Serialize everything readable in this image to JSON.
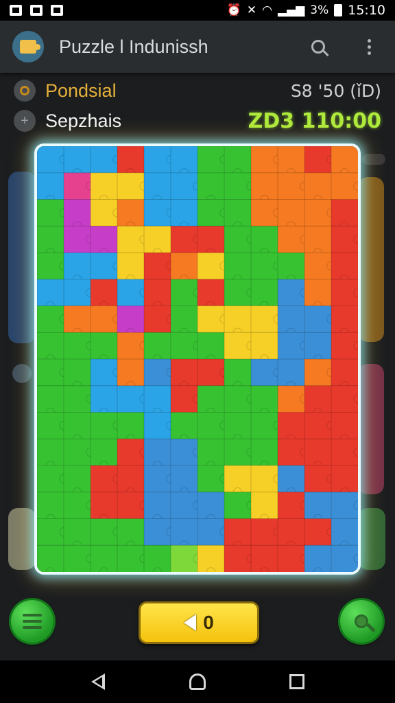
{
  "status_bar": {
    "left_icons": [
      "photo-icon",
      "gallery-icon",
      "notification-icon"
    ],
    "right_icons": [
      "alarm-icon",
      "mute-icon",
      "wifi-icon",
      "signal-icon",
      "battery-icon"
    ],
    "battery": "3%",
    "time": "15:10"
  },
  "app_bar": {
    "title": "Puzzle l Indunissh",
    "icons": [
      "app-icon",
      "search-icon",
      "more-vertical-icon"
    ]
  },
  "info": {
    "row1": {
      "label": "Pondsial",
      "value": "S8 '50 (ǐD)",
      "icon": "coin-icon"
    },
    "row2": {
      "label": "Sepzhais",
      "value": "ZD3 110:00",
      "icon": "plus-icon"
    }
  },
  "board": {
    "cols": 12,
    "rows": 16,
    "colors": {
      "B": "#2aa4e6",
      "b": "#3b8fd6",
      "G": "#37c232",
      "g": "#7fd83a",
      "O": "#f57a22",
      "R": "#e83a2c",
      "Y": "#f6cf27",
      "P": "#c63ec8",
      "M": "#e5418f"
    },
    "grid": [
      "BBBRBBGGOORO",
      "BMYYBBGGOOOO",
      "GPYOBBGGOOOR",
      "GPPYYRRGGOOR",
      "GBBYROYGGGOR",
      "BBRBRGRGGbOR",
      "GOOPRGYYYbbR",
      "GGGOGGGYYbbR",
      "GGBObRRGbbOR",
      "GGBBBRGGGORR",
      "GGGGBGGGGRRR",
      "GGGRbbGGGRRR",
      "GGRRbbGYYbRR",
      "GGRRbbbGYRbb",
      "GGGGbbbRRRRb",
      "GGGGGgYRRRbb"
    ]
  },
  "bottom_bar": {
    "left_icon": "menu-lines-icon",
    "center_label": "0",
    "center_icon": "back-arrow-icon",
    "right_icon": "hint-magnifier-icon"
  },
  "nav_bar": {
    "icons": [
      "nav-back-icon",
      "nav-home-icon",
      "nav-recents-icon"
    ]
  }
}
